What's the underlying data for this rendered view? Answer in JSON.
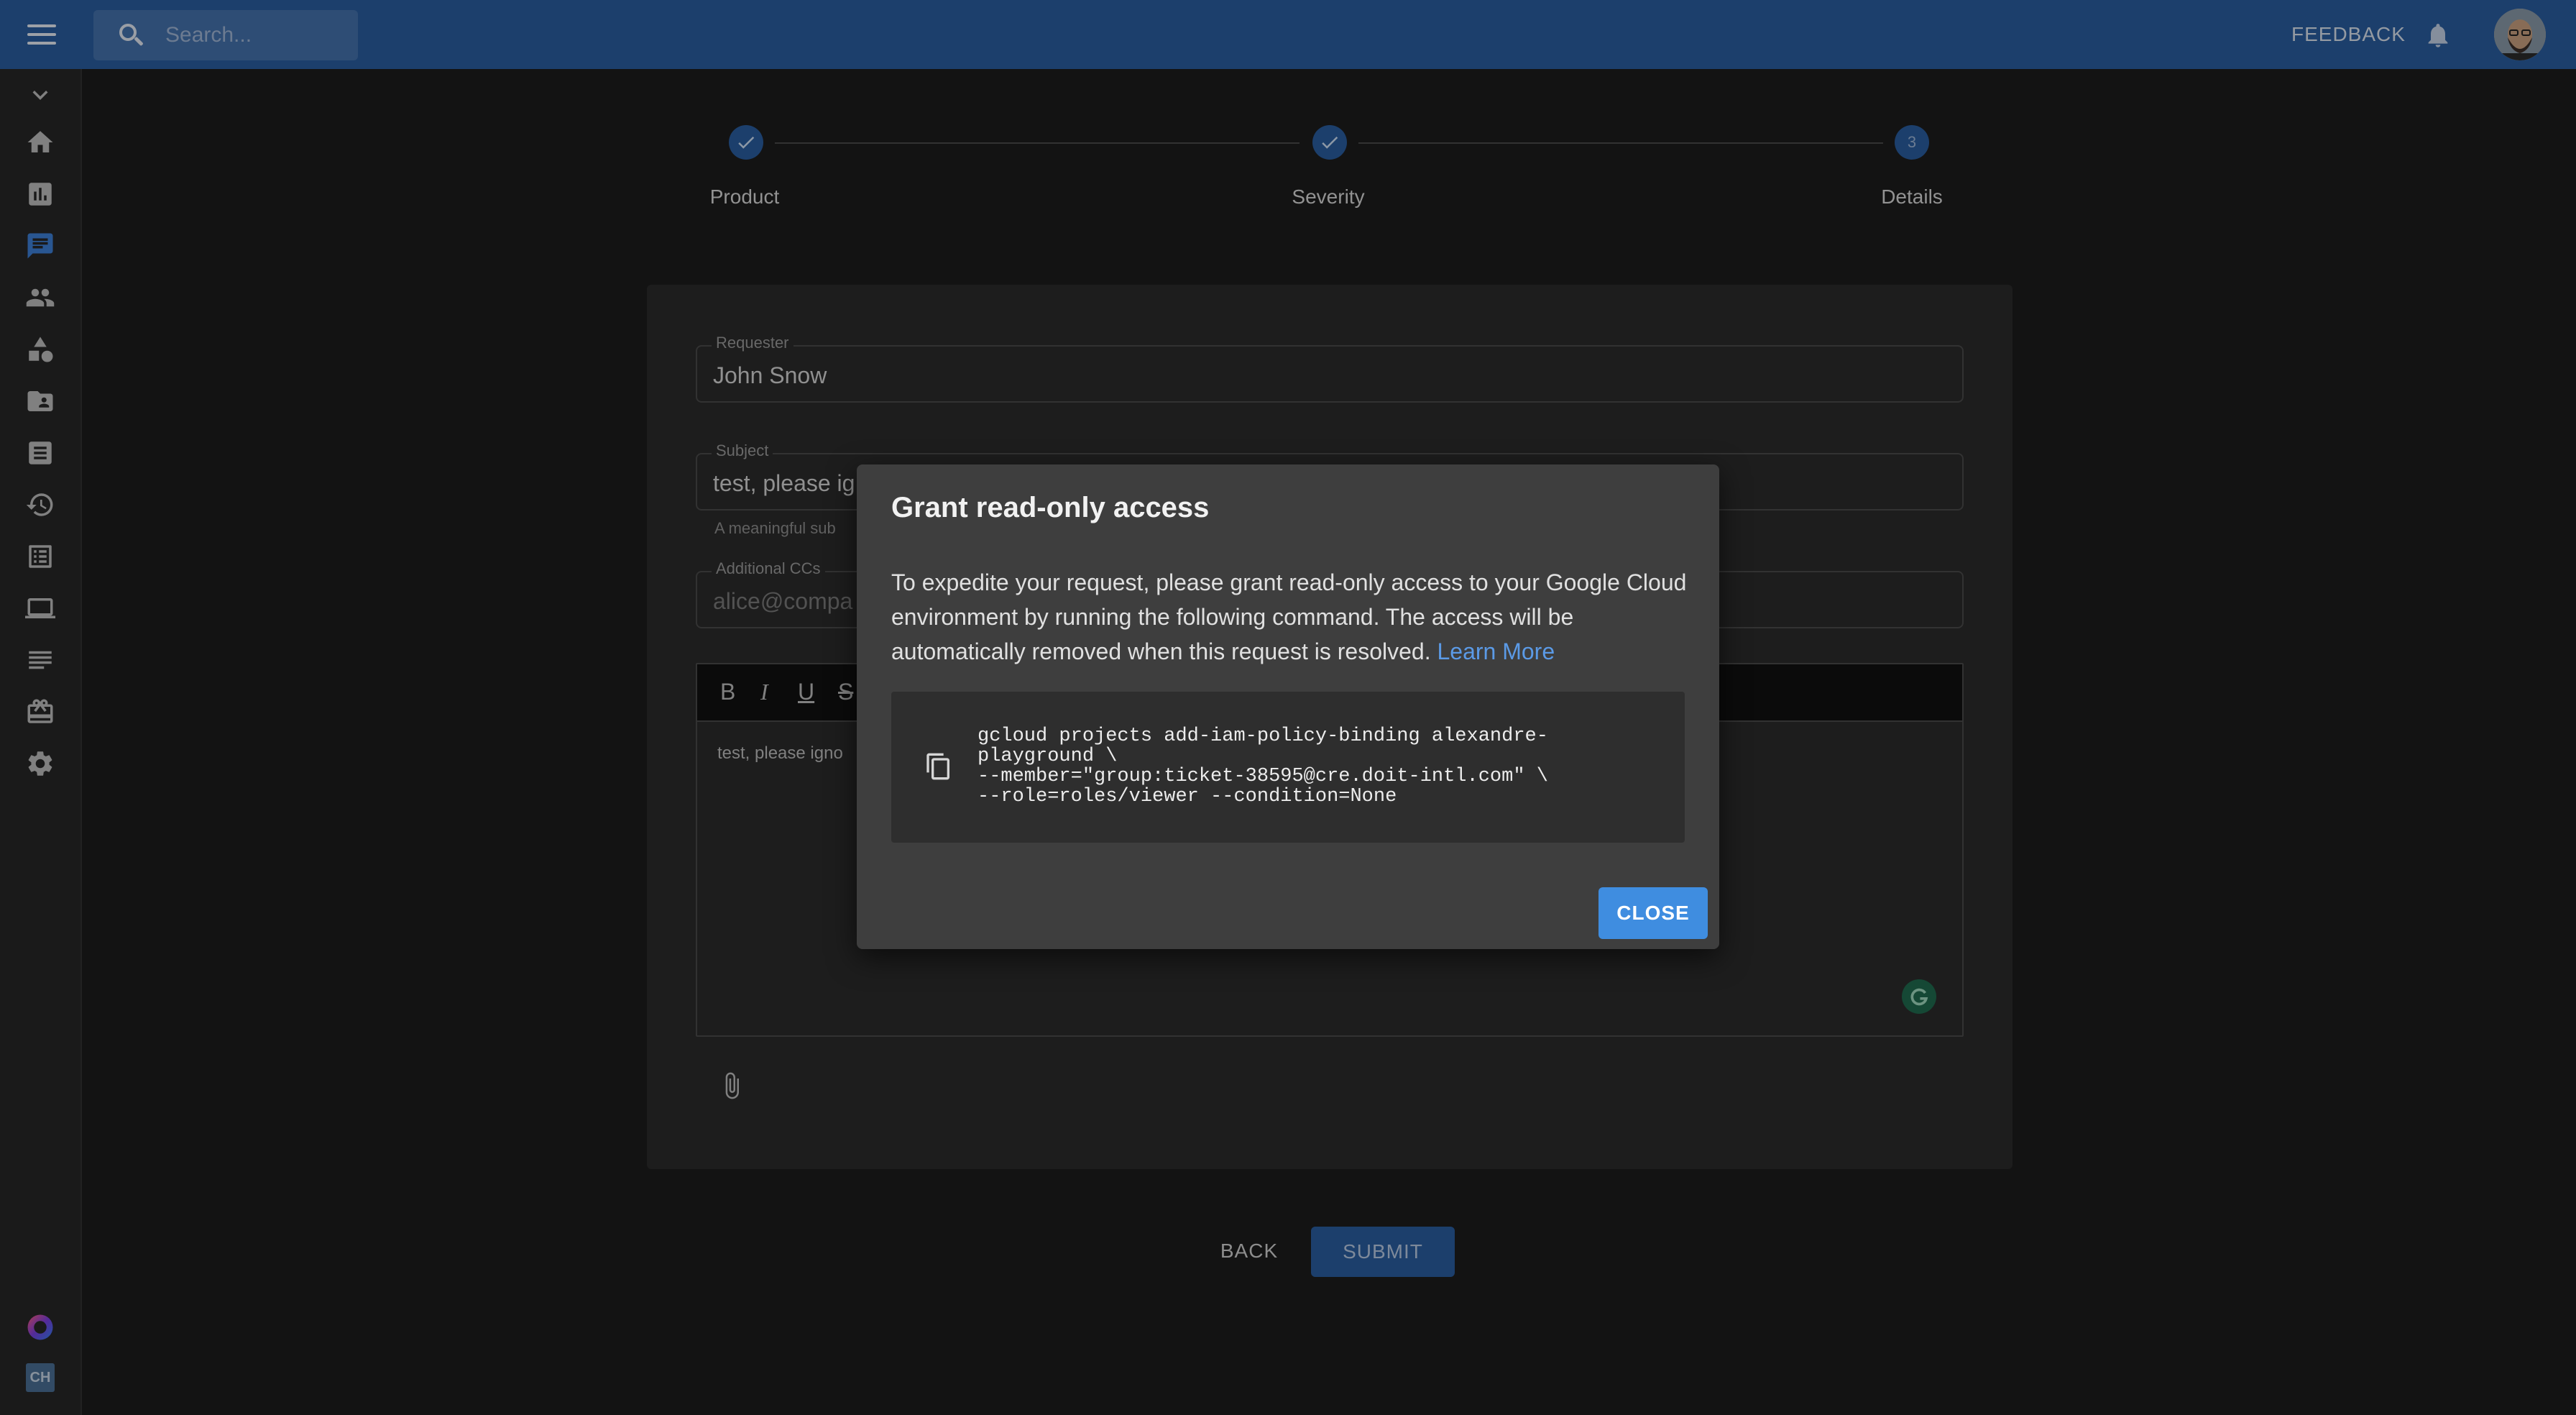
{
  "topbar": {
    "search_placeholder": "Search...",
    "feedback_label": "FEEDBACK"
  },
  "sidenav": {
    "items": [
      "chevron-down-icon",
      "home-icon",
      "chart-icon",
      "chat-icon",
      "people-icon",
      "shapes-icon",
      "folder-account-icon",
      "document-icon",
      "history-icon",
      "list-icon",
      "laptop-icon",
      "lines-icon",
      "gift-icon",
      "gear-icon"
    ],
    "bottom_badge": "CH"
  },
  "stepper": {
    "steps": [
      {
        "label": "Product",
        "state": "completed"
      },
      {
        "label": "Severity",
        "state": "completed"
      },
      {
        "label": "Details",
        "state": "active",
        "number": "3"
      }
    ]
  },
  "form": {
    "requester_label": "Requester",
    "requester_value": "John Snow",
    "subject_label": "Subject",
    "subject_value": "test, please ig",
    "subject_helper": "A meaningful sub",
    "cc_label": "Additional CCs",
    "cc_placeholder": "alice@compa",
    "toolbar": {
      "bold": "B",
      "italic": "I",
      "underline": "U",
      "strike": "S"
    },
    "body_text": "test, please igno"
  },
  "actions": {
    "back_label": "BACK",
    "submit_label": "SUBMIT"
  },
  "dialog": {
    "title": "Grant read-only access",
    "body": "To expedite your request, please grant read-only access to your Google Cloud environment by running the following command. The access will be automatically removed when this request is resolved.",
    "link_text": "Learn More",
    "command": "gcloud projects add-iam-policy-binding alexandre-\nplayground \\\n--member=\"group:ticket-38595@cre.doit-intl.com\" \\\n--role=roles/viewer --condition=None",
    "close_label": "CLOSE"
  },
  "colors": {
    "topbar": "#2a5ea0",
    "accent": "#3f8de0",
    "link": "#5b9ae6",
    "background": "#1c1c1c"
  }
}
